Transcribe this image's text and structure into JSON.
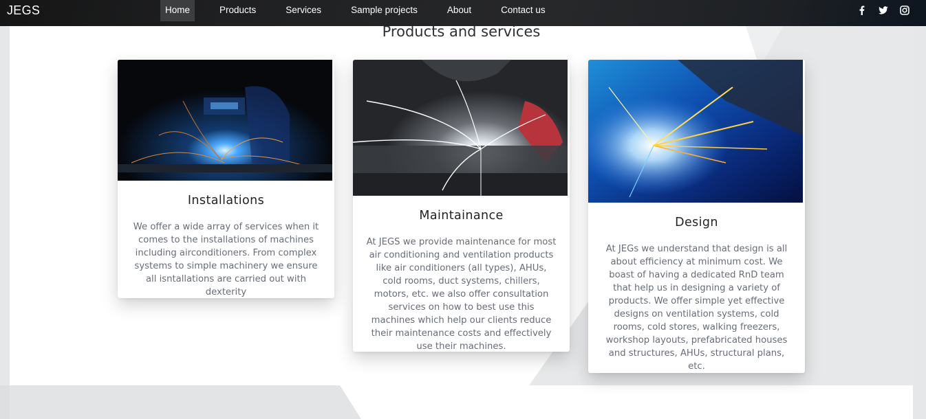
{
  "navbar": {
    "brand": "JEGS",
    "items": [
      {
        "label": "Home",
        "active": true
      },
      {
        "label": "Products",
        "active": false
      },
      {
        "label": "Services",
        "active": false
      },
      {
        "label": "Sample projects",
        "active": false
      },
      {
        "label": "About",
        "active": false
      },
      {
        "label": "Contact us",
        "active": false
      }
    ],
    "social": [
      "facebook-icon",
      "twitter-icon",
      "instagram-icon"
    ]
  },
  "section": {
    "title": "Products and services"
  },
  "cards": [
    {
      "title": "Installations",
      "image": "welding-sparks-blue-photo",
      "text": "We offer a wide array of services when it comes to the installations of machines including airconditioners. From complex systems to simple machinery we ensure all isntallations are carried out with dexterity"
    },
    {
      "title": "Maintainance",
      "image": "welding-sparks-white-photo",
      "text": "At JEGS we provide maintenance for most air conditioning and ventilation products like air conditioners (all types), AHUs, cold rooms, duct systems, chillers, motors, etc. we also offer consultation services on how to best use this machines which help our clients reduce their maintenance costs and effectively use their machines."
    },
    {
      "title": "Design",
      "image": "welding-sparks-colorful-photo",
      "text": "At JEGs we understand that design is all about efficiency at minimum cost. We boast of having a dedicated RnD team that help us in designing a variety of products. We offer simple yet effective designs on ventilation systems, cold rooms, cold stores, walking freezers, workshop layouts, prefabricated houses and structures, AHUs, structural plans, etc."
    }
  ],
  "colors": {
    "navbar": "#1f2022",
    "background": "#e6e7e8",
    "card_text": "#676d76",
    "accent_active": "#3d3e40"
  }
}
